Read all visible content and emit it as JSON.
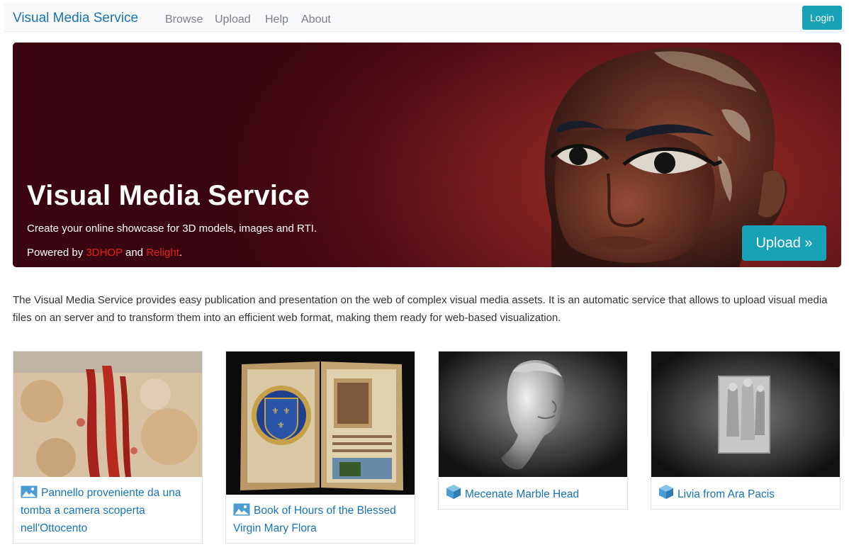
{
  "navbar": {
    "brand": "Visual Media Service",
    "links": [
      "Browse",
      "Upload",
      "Help",
      "About"
    ],
    "login": "Login"
  },
  "hero": {
    "title": "Visual Media Service",
    "subtitle": "Create your online showcase for 3D models, images and RTI.",
    "powered_prefix": "Powered by ",
    "powered_link1": "3DHOP",
    "powered_mid": " and ",
    "powered_link2": "Relight",
    "powered_suffix": ".",
    "upload_button": "Upload »"
  },
  "description": "The Visual Media Service provides easy publication and presentation on the web of complex visual media assets. It is an automatic service that allows to upload visual media files on an server and to transform them into an efficient web format, making them ready for web-based visualization.",
  "cards": [
    {
      "title": "Pannello proveniente da una tomba a camera scoperta nell'Ottocento",
      "icon": "image-icon"
    },
    {
      "title": "Book of Hours of the Blessed Virgin Mary Flora",
      "icon": "image-icon"
    },
    {
      "title": "Mecenate Marble Head",
      "icon": "cube-icon"
    },
    {
      "title": "Livia from Ara Pacis",
      "icon": "cube-icon"
    }
  ],
  "colors": {
    "brand": "#1a73b5",
    "accent": "#17a2b8",
    "hero_dark": "#520c17",
    "highlight_red": "#e32020"
  }
}
